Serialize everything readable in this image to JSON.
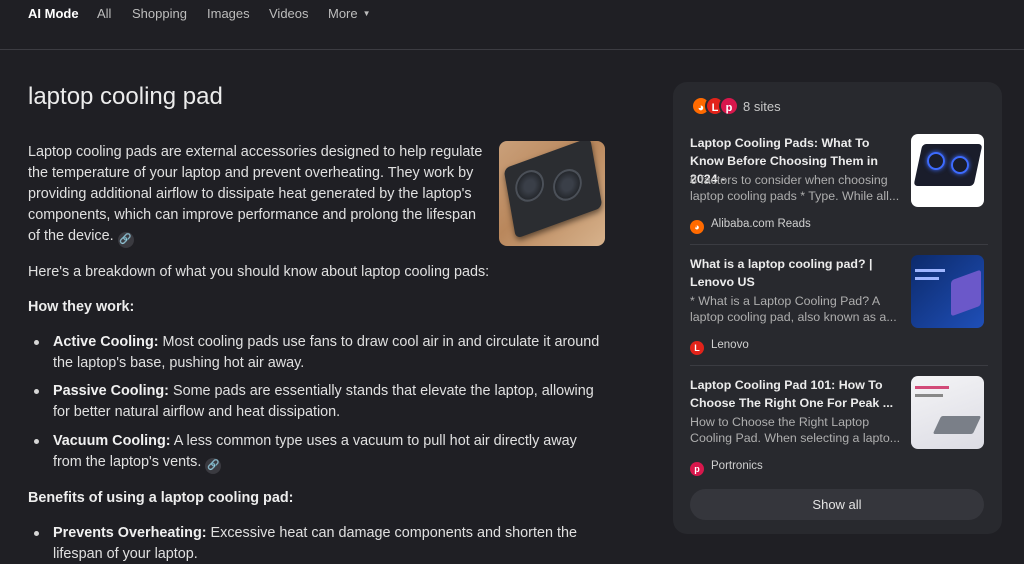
{
  "nav": {
    "tabs": [
      "AI Mode",
      "All",
      "Shopping",
      "Images",
      "Videos",
      "More"
    ]
  },
  "query_title": "laptop cooling pad",
  "intro": "Laptop cooling pads are external accessories designed to help regulate the temperature of your laptop and prevent overheating. They work by providing additional airflow to dissipate heat generated by the laptop's components, which can improve performance and prolong the lifespan of the device.",
  "breakdown": "Here's a breakdown of what you should know about laptop cooling pads:",
  "how_heading": "How they work:",
  "how_items": [
    {
      "term": "Active Cooling:",
      "text": " Most cooling pads use fans to draw cool air in and circulate it around the laptop's base, pushing hot air away."
    },
    {
      "term": "Passive Cooling:",
      "text": " Some pads are essentially stands that elevate the laptop, allowing for better natural airflow and heat dissipation."
    },
    {
      "term": "Vacuum Cooling:",
      "text": " A less common type uses a vacuum to pull hot air directly away from the laptop's vents."
    }
  ],
  "benefits_heading": "Benefits of using a laptop cooling pad:",
  "benefit_items": [
    {
      "term": "Prevents Overheating:",
      "text": " Excessive heat can damage components and shorten the lifespan of your laptop."
    }
  ],
  "icons": {
    "link": "link-icon"
  },
  "panel": {
    "sites_count": "8 sites",
    "sources": [
      {
        "title": "Laptop Cooling Pads: What To Know Before Choosing Them in 2024 -",
        "snippet": "6 factors to consider when choosing laptop cooling pads * Type. While all...",
        "source_name": "Alibaba.com Reads",
        "icon_color": "#ff6a00"
      },
      {
        "title": "What is a laptop cooling pad? | Lenovo US",
        "snippet": "* What is a Laptop Cooling Pad? A laptop cooling pad, also known as a...",
        "source_name": "Lenovo",
        "icon_color": "#e2231a"
      },
      {
        "title": "Laptop Cooling Pad 101: How To Choose The Right One For Peak ...",
        "snippet": "How to Choose the Right Laptop Cooling Pad. When selecting a lapto...",
        "source_name": "Portronics",
        "icon_color": "#d8174c"
      }
    ],
    "show_all": "Show all"
  },
  "colors": {
    "background": "#1f1f24",
    "panel": "#28292e",
    "text": "#e3e3e3"
  }
}
